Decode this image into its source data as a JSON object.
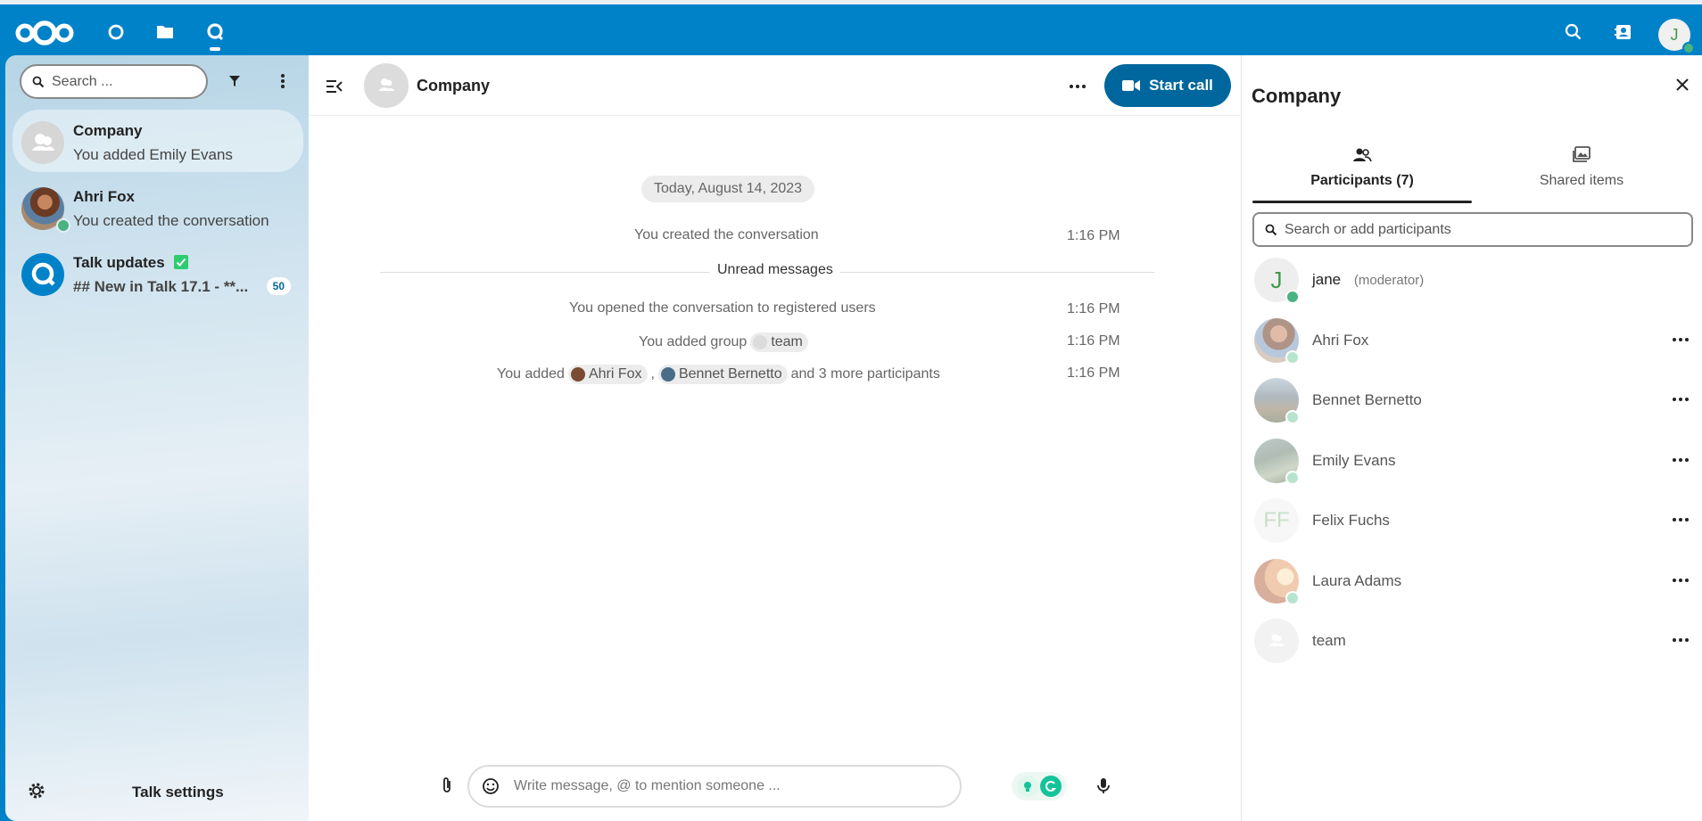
{
  "header": {
    "apps": [
      {
        "name": "Dashboard",
        "icon": "dashboard-icon"
      },
      {
        "name": "Files",
        "icon": "folder-icon"
      },
      {
        "name": "Talk",
        "icon": "talk-icon"
      }
    ],
    "search_icon": "search-icon",
    "contacts_icon": "contacts-icon",
    "user_initial": "J"
  },
  "sidebar": {
    "search_placeholder": "Search ...",
    "conversations": [
      {
        "name": "Company",
        "last_message": "You added Emily Evans"
      },
      {
        "name": "Ahri Fox",
        "last_message": "You created the conversation"
      },
      {
        "name": "Talk updates",
        "last_message": "## New in Talk 17.1 - **...",
        "unread": "50"
      }
    ],
    "settings_label": "Talk settings"
  },
  "chat": {
    "title": "Company",
    "start_call_label": "Start call",
    "date_separator": "Today, August 14, 2023",
    "messages": [
      {
        "text": "You created the conversation",
        "time": "1:16 PM"
      },
      {
        "text": "You opened the conversation to registered users",
        "time": "1:16 PM"
      },
      {
        "text_prefix": "You added group",
        "chip": "team",
        "time": "1:16 PM"
      },
      {
        "text_prefix": "You added",
        "chip1": "Ahri Fox",
        "separator": ",",
        "chip2": "Bennet Bernetto",
        "suffix": "and 3 more participants",
        "time": "1:16 PM"
      }
    ],
    "unread_label": "Unread messages",
    "composer_placeholder": "Write message, @ to mention someone ..."
  },
  "right_panel": {
    "title": "Company",
    "tabs": [
      {
        "label": "Participants (7)",
        "icon": "people-icon"
      },
      {
        "label": "Shared items",
        "icon": "images-icon"
      }
    ],
    "search_placeholder": "Search or add participants",
    "participants": [
      {
        "name": "jane",
        "role": "(moderator)",
        "initials": "J"
      },
      {
        "name": "Ahri Fox"
      },
      {
        "name": "Bennet Bernetto"
      },
      {
        "name": "Emily Evans"
      },
      {
        "name": "Felix Fuchs",
        "initials": "FF"
      },
      {
        "name": "Laura Adams"
      },
      {
        "name": "team"
      }
    ]
  },
  "colors": {
    "brand": "#0082c9",
    "primary_button": "#00679e",
    "online": "#49b382"
  }
}
